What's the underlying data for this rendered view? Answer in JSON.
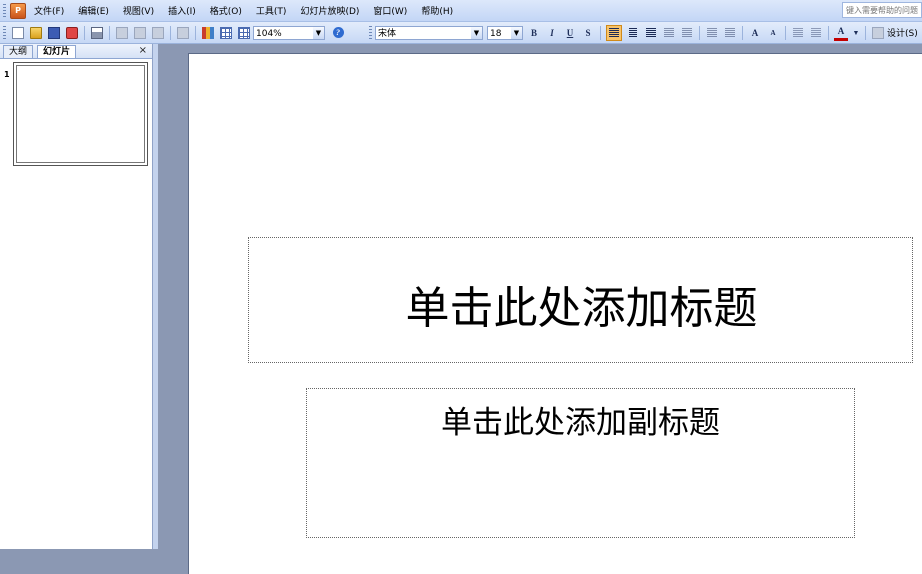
{
  "app": {
    "icon": "powerpoint-icon"
  },
  "menu": {
    "items": [
      {
        "label": "文件(F)"
      },
      {
        "label": "编辑(E)"
      },
      {
        "label": "视图(V)"
      },
      {
        "label": "插入(I)"
      },
      {
        "label": "格式(O)"
      },
      {
        "label": "工具(T)"
      },
      {
        "label": "幻灯片放映(D)"
      },
      {
        "label": "窗口(W)"
      },
      {
        "label": "帮助(H)"
      }
    ],
    "help_placeholder": "键入需要帮助的问题"
  },
  "toolbar": {
    "zoom": "104%",
    "font_name": "宋体",
    "font_size": "18",
    "bold": "B",
    "italic": "I",
    "underline": "U",
    "shadow": "S",
    "grow_font": "A",
    "shrink_font": "A",
    "font_color": "A",
    "design_label": "设计(S)"
  },
  "left_pane": {
    "tabs": [
      {
        "label": "大纲"
      },
      {
        "label": "幻灯片"
      }
    ],
    "close": "×",
    "slide_number": "1"
  },
  "slide": {
    "title_placeholder": "单击此处添加标题",
    "subtitle_placeholder": "单击此处添加副标题"
  },
  "colors": {
    "workspace": "#8b98b3",
    "toolbar": "#c6d8f5",
    "font_color_bar": "#c40000"
  }
}
